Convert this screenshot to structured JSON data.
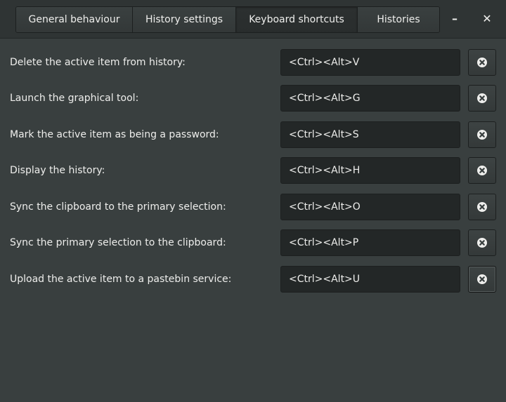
{
  "tabs": [
    {
      "label": "General behaviour"
    },
    {
      "label": "History settings"
    },
    {
      "label": "Keyboard shortcuts",
      "active": true
    },
    {
      "label": "Histories"
    }
  ],
  "window_controls": {
    "minimize": "–",
    "close": "✕"
  },
  "shortcuts": [
    {
      "label": "Delete the active item from history:",
      "value": "<Ctrl><Alt>V"
    },
    {
      "label": "Launch the graphical tool:",
      "value": "<Ctrl><Alt>G"
    },
    {
      "label": "Mark the active item as being a password:",
      "value": "<Ctrl><Alt>S"
    },
    {
      "label": "Display the history:",
      "value": "<Ctrl><Alt>H"
    },
    {
      "label": "Sync the clipboard to the primary selection:",
      "value": "<Ctrl><Alt>O"
    },
    {
      "label": "Sync the primary selection to the clipboard:",
      "value": "<Ctrl><Alt>P"
    },
    {
      "label": "Upload the active item to a pastebin service:",
      "value": "<Ctrl><Alt>U"
    }
  ],
  "icons": {
    "clear": "edit-clear-icon"
  },
  "colors": {
    "background": "#393f3f",
    "field_background": "#232727",
    "text": "#eeeeec"
  }
}
